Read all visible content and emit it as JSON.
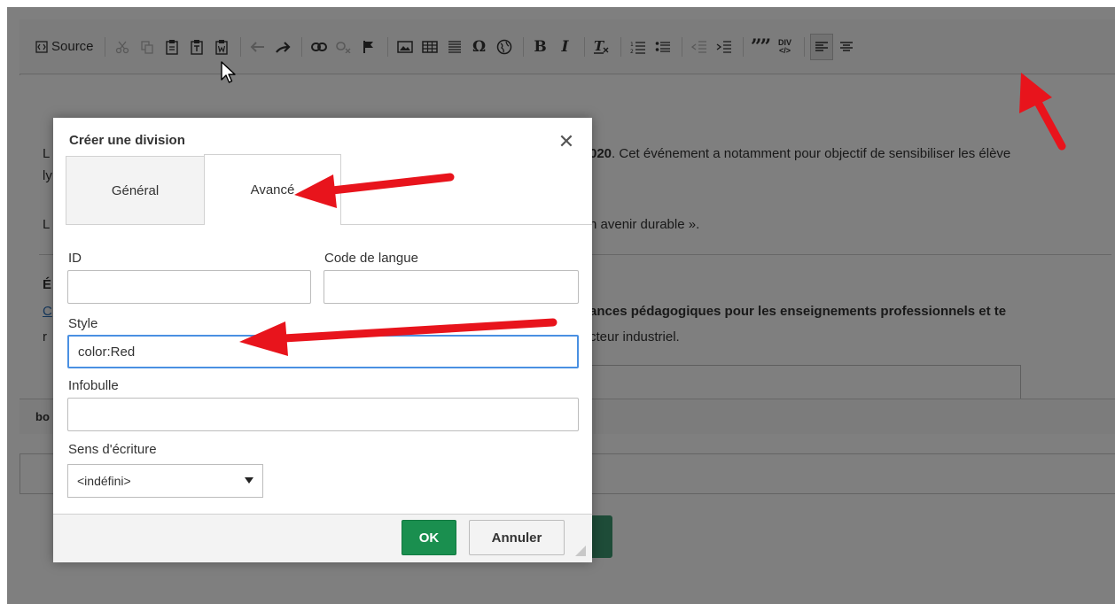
{
  "toolbar": {
    "source_label": "Source",
    "bold_label": "B",
    "italic_label": "I",
    "remove_format_label": "Tx",
    "blockquote_label": "”",
    "div_label": "DIV",
    "omega_label": "Ω"
  },
  "editor": {
    "line1_prefix": "L",
    "line1_bold": "020",
    "line1_rest": ". Cet événement a notamment pour objectif de sensibiliser les élève",
    "line1b": "ly",
    "line2_prefix": "L",
    "line2_rest": "n avenir durable ».",
    "line3_prefix": "É",
    "line4_prefix": "C",
    "line4_bold": "ances pédagogiques pour les enseignements professionnels et te",
    "line5_prefix": "r",
    "line5_rest": "cteur industriel.",
    "path_label": "bo"
  },
  "dialog": {
    "title": "Créer une division",
    "close_glyph": "✕",
    "tabs": [
      {
        "label": "Général",
        "active": false
      },
      {
        "label": "Avancé",
        "active": true
      }
    ],
    "fields": {
      "id_label": "ID",
      "id_value": "",
      "lang_label": "Code de langue",
      "lang_value": "",
      "style_label": "Style",
      "style_value": "color:Red",
      "tooltip_label": "Infobulle",
      "tooltip_value": "",
      "dir_label": "Sens d'écriture",
      "dir_value": "<indéfini>"
    },
    "ok_label": "OK",
    "cancel_label": "Annuler"
  },
  "colors": {
    "accent_focus": "#4a90e2",
    "ok_green": "#1a8f4f",
    "arrow_red": "#e8141c"
  }
}
